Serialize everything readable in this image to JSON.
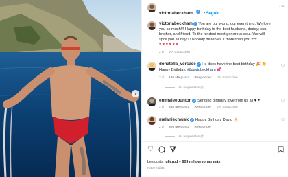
{
  "post": {
    "author": "victoriabeckham",
    "follow_label": "Seguir",
    "more_icon": "more-horizontal-icon",
    "caption_lines": [
      "You are our world, our everything. We love",
      "you so much!!! Happy birthday to the best husband, daddy, son,",
      "brother, and friend. To the kindest most generous soul. We will",
      "spoil you all day!!!! Nobody deserves it more than you xxx"
    ],
    "caption_hearts": "♥ ♥ ♥ ♥ ♥ ♥",
    "caption_time": "2 d",
    "see_translation": "Ver traducción"
  },
  "comments": [
    {
      "user": "donatella_versace",
      "line1": "He does have the best birthday 🎉 👏",
      "line2_prefix": "Happy Birthday, ",
      "mention": "@davidbeckham",
      "line2_suffix": " 💕",
      "time": "2 d",
      "likes": "186 Me gusta",
      "reply": "Responder",
      "translate": "Ver traducción",
      "see_replies": "Ver respuestas (5)"
    },
    {
      "user": "emmaleebunton",
      "line1": "Sending birthday love from us all ♥ ♥",
      "time": "2 d",
      "likes": "538 Me gusta",
      "reply": "Responder",
      "translate": "Ver traducción"
    },
    {
      "user": "melaniecmusic",
      "line1": "Happy Birthday David 🎂",
      "time": "2 d",
      "likes": "806 Me gusta",
      "reply": "Responder",
      "see_replies": "Ver respuestas (7)"
    }
  ],
  "actions": {
    "icons": [
      "heart-icon",
      "comment-icon",
      "share-icon",
      "save-icon"
    ],
    "likes_prefix": "Les gusta ",
    "likes_user": "julicrud",
    "likes_suffix": " y 603 mil personas más",
    "date": "Hace 2 días"
  },
  "colors": {
    "accent": "#0095f6",
    "verified": "#3897f0",
    "text": "#262626",
    "muted": "#8e8e8e",
    "mention": "#00376b"
  }
}
